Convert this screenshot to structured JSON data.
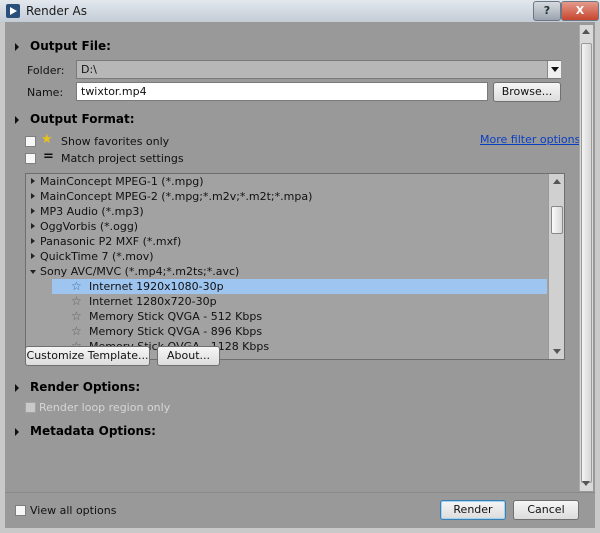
{
  "window": {
    "title": "Render As",
    "help_label": "?",
    "close_label": "X"
  },
  "output_file": {
    "heading": "Output File:",
    "folder_label": "Folder:",
    "folder_value": "D:\\",
    "name_label": "Name:",
    "name_value": "twixtor.mp4",
    "browse_label": "Browse..."
  },
  "output_format": {
    "heading": "Output Format:",
    "show_favorites_label": "Show favorites only",
    "match_project_label": "Match project settings",
    "more_filter_label": "More filter options",
    "list": [
      {
        "label": "MainConcept MPEG-1 (*.mpg)",
        "kind": "collapsed"
      },
      {
        "label": "MainConcept MPEG-2 (*.mpg;*.m2v;*.m2t;*.mpa)",
        "kind": "collapsed"
      },
      {
        "label": "MP3 Audio (*.mp3)",
        "kind": "collapsed"
      },
      {
        "label": "OggVorbis (*.ogg)",
        "kind": "collapsed"
      },
      {
        "label": "Panasonic P2 MXF (*.mxf)",
        "kind": "collapsed"
      },
      {
        "label": "QuickTime 7 (*.mov)",
        "kind": "collapsed"
      },
      {
        "label": "Sony AVC/MVC (*.mp4;*.m2ts;*.avc)",
        "kind": "expanded"
      },
      {
        "label": "Internet 1920x1080-30p",
        "kind": "child",
        "selected": true
      },
      {
        "label": "Internet 1280x720-30p",
        "kind": "child"
      },
      {
        "label": "Memory Stick QVGA - 512 Kbps",
        "kind": "child"
      },
      {
        "label": "Memory Stick QVGA - 896 Kbps",
        "kind": "child"
      },
      {
        "label": "Memory Stick QVGA - 1128 Kbps",
        "kind": "child"
      }
    ],
    "customize_label": "Customize Template...",
    "about_label": "About..."
  },
  "render_options": {
    "heading": "Render Options:",
    "loop_region_label": "Render loop region only"
  },
  "metadata_options": {
    "heading": "Metadata Options:"
  },
  "footer": {
    "view_all_label": "View all options",
    "render_label": "Render",
    "cancel_label": "Cancel"
  },
  "icons": {
    "favorite": "star-icon",
    "match": "equals-icon",
    "expand": "triangle-right-icon",
    "collapse": "triangle-down-icon"
  },
  "colors": {
    "selection": "#9dc5f0",
    "link": "#0a3ec2",
    "dialog_bg": "#999999"
  }
}
